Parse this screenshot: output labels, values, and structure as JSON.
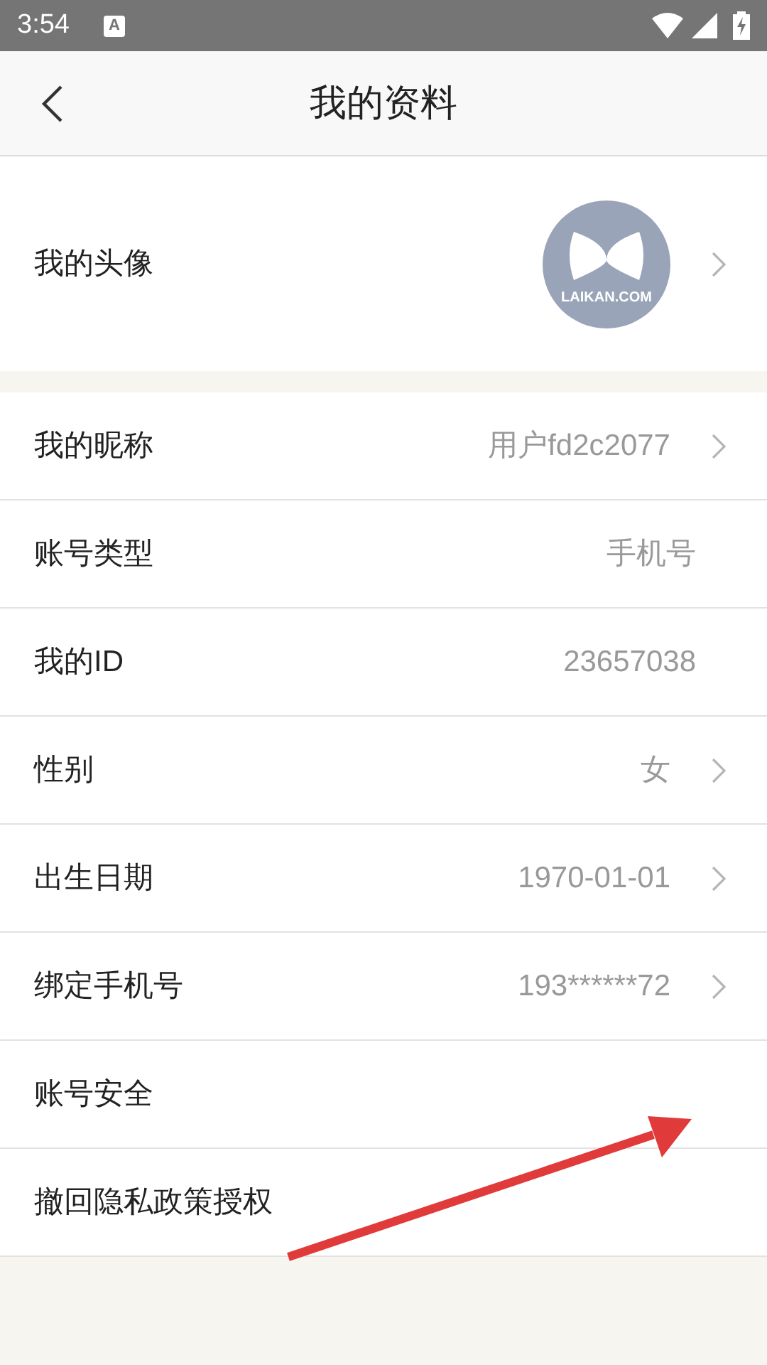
{
  "status_bar": {
    "time": "3:54",
    "notification_letter": "A"
  },
  "header": {
    "title": "我的资料"
  },
  "avatar_row": {
    "label": "我的头像",
    "logo_text": "LAIKAN.COM",
    "chevron": true
  },
  "rows": [
    {
      "label": "我的昵称",
      "value": "用户fd2c2077",
      "chevron": true
    },
    {
      "label": "账号类型",
      "value": "手机号",
      "chevron": false
    },
    {
      "label": "我的ID",
      "value": "23657038",
      "chevron": false
    },
    {
      "label": "性别",
      "value": "女",
      "chevron": true
    },
    {
      "label": "出生日期",
      "value": "1970-01-01",
      "chevron": true
    },
    {
      "label": "绑定手机号",
      "value": "193******72",
      "chevron": true
    },
    {
      "label": "账号安全",
      "chevron": false
    },
    {
      "label": "撤回隐私政策授权",
      "chevron": false
    }
  ]
}
